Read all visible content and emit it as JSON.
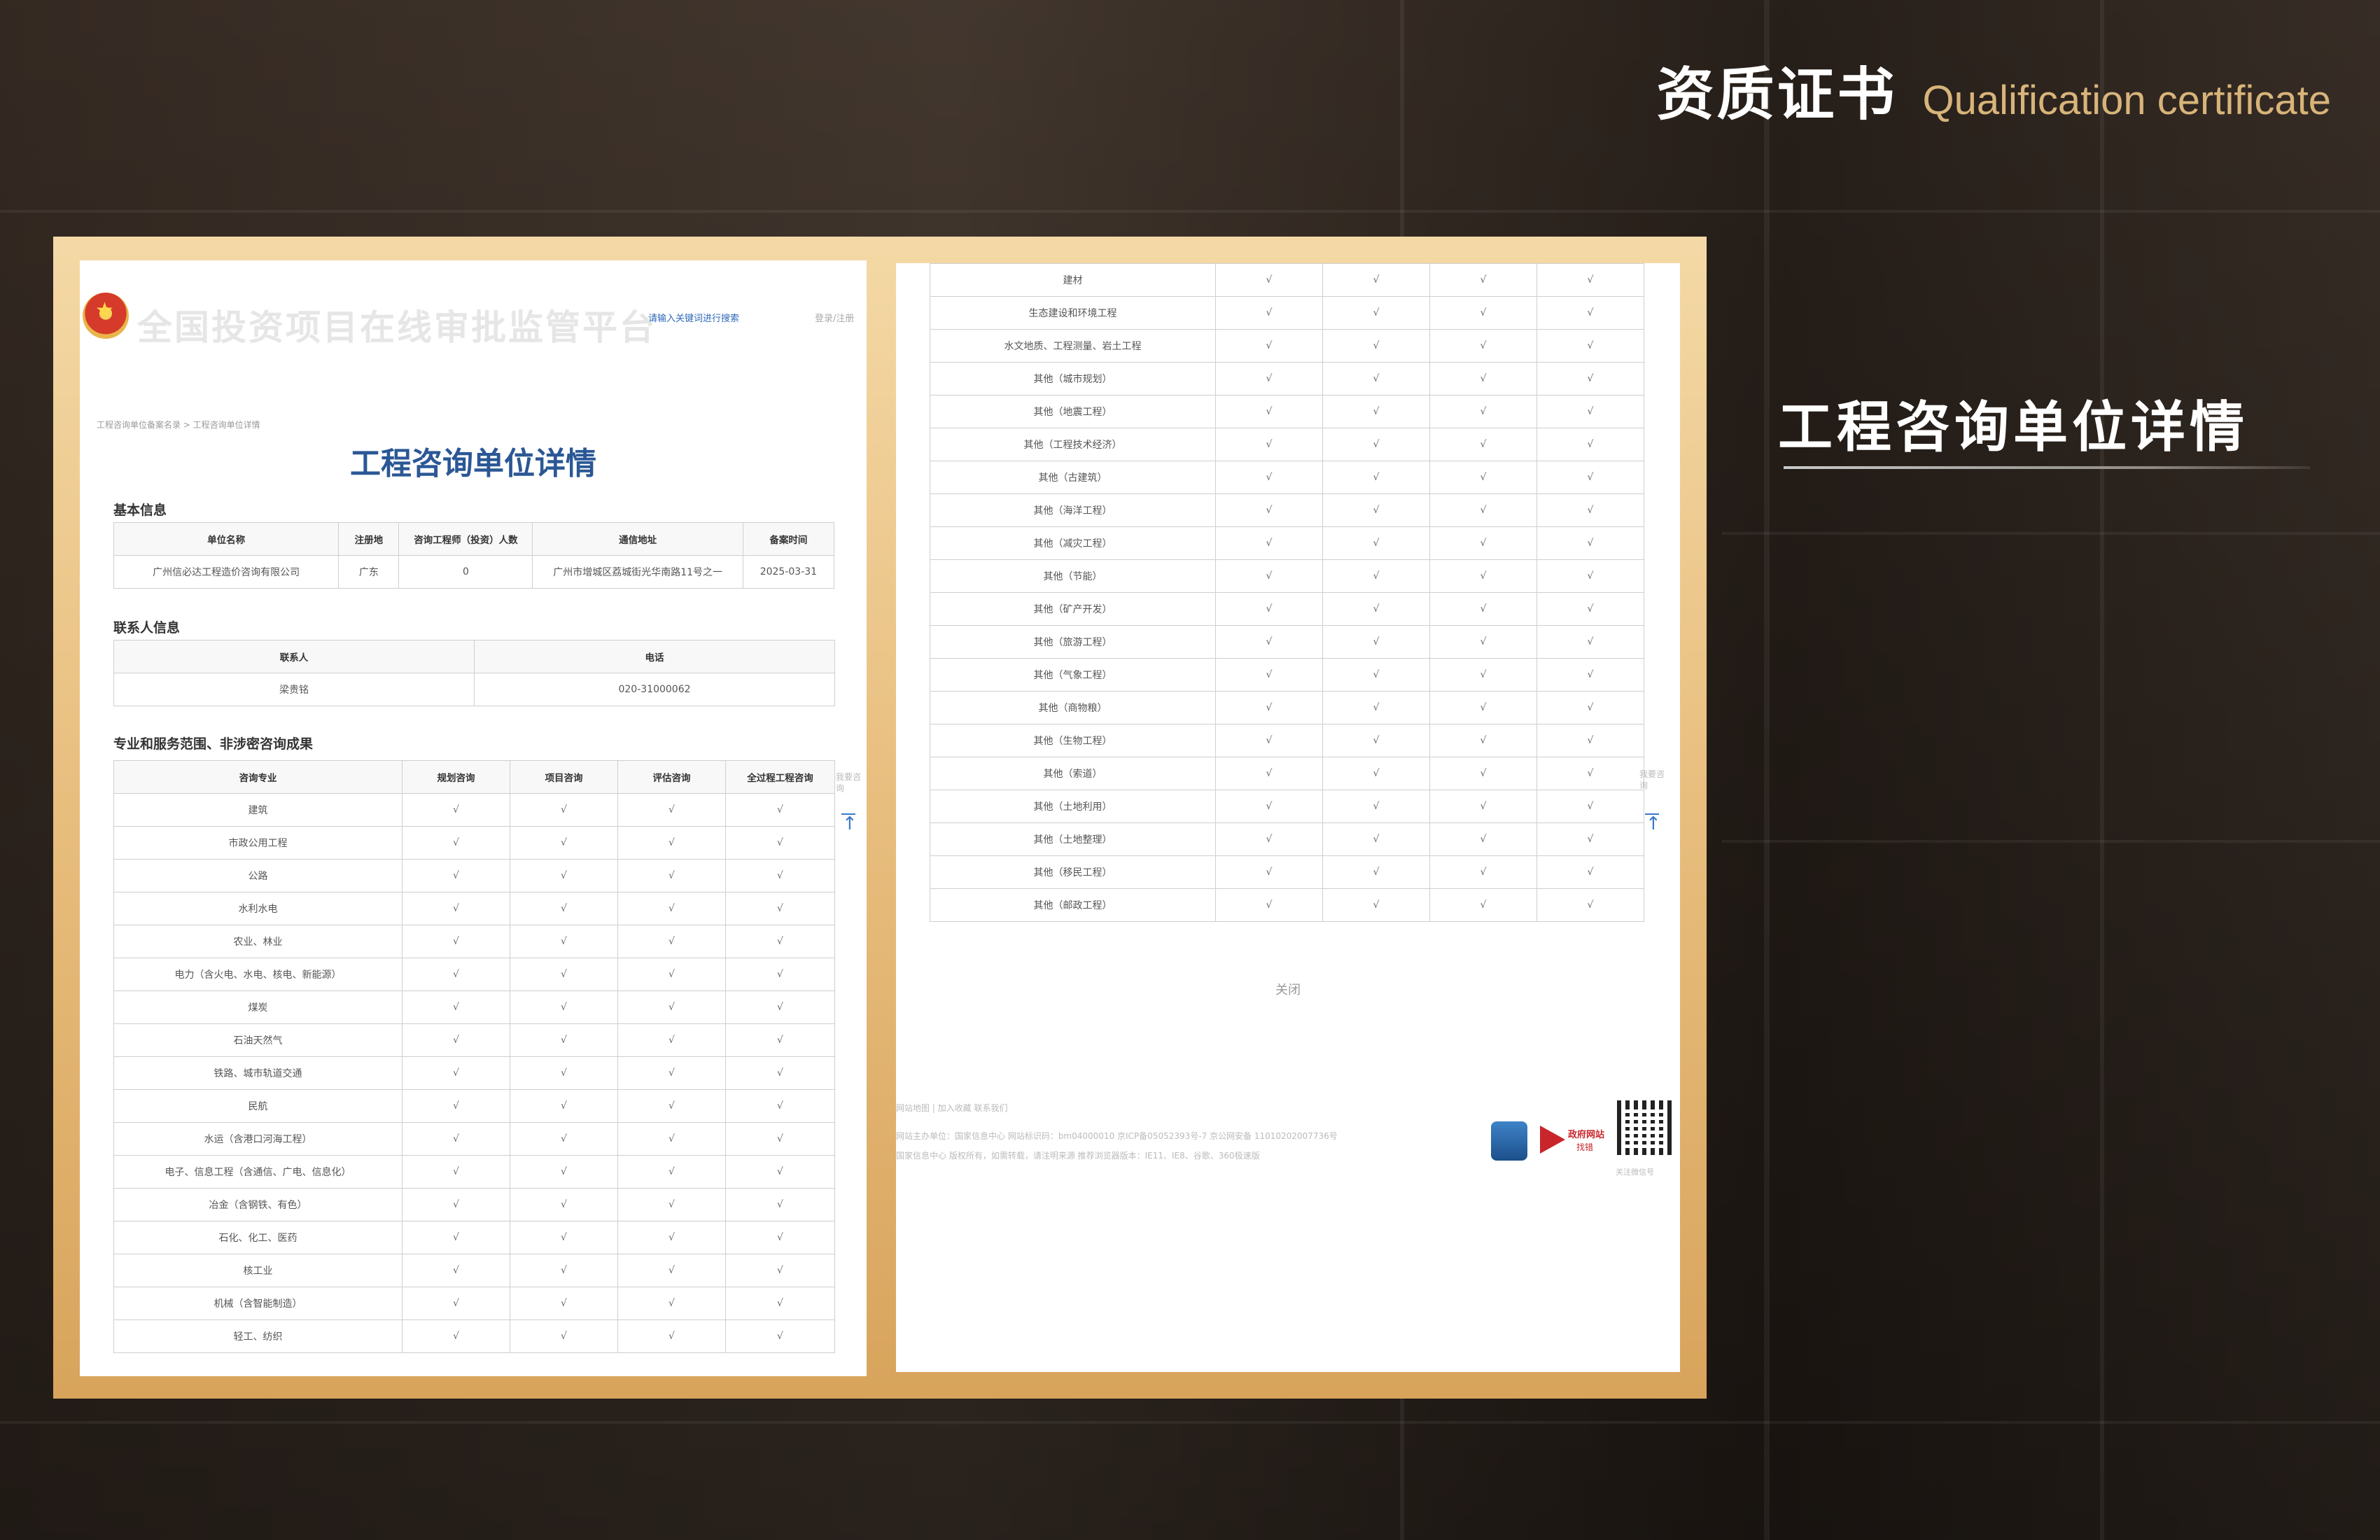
{
  "header": {
    "title_cn": "资质证书",
    "title_en": "Qualification certificate"
  },
  "side": {
    "title": "工程咨询单位详情"
  },
  "left_page": {
    "platform_title": "全国投资项目在线审批监管平台",
    "search_link": "请输入关键词进行搜索",
    "login": "登录/注册",
    "breadcrumb": "工程咨询单位备案名录 > 工程咨询单位详情",
    "page_title": "工程咨询单位详情",
    "basic_info": {
      "heading": "基本信息",
      "headers": [
        "单位名称",
        "注册地",
        "咨询工程师（投资）人数",
        "通信地址",
        "备案时间"
      ],
      "row": [
        "广州信必达工程造价咨询有限公司",
        "广东",
        "0",
        "广州市增城区荔城街光华南路11号之一",
        "2025-03-31"
      ]
    },
    "contact_info": {
      "heading": "联系人信息",
      "headers": [
        "联系人",
        "电话"
      ],
      "row": [
        "梁贵铭",
        "020-31000062"
      ]
    },
    "scope": {
      "heading": "专业和服务范围、非涉密咨询成果",
      "headers": [
        "咨询专业",
        "规划咨询",
        "项目咨询",
        "评估咨询",
        "全过程工程咨询"
      ],
      "check": "√",
      "rows": [
        "建筑",
        "市政公用工程",
        "公路",
        "水利水电",
        "农业、林业",
        "电力（含火电、水电、核电、新能源）",
        "煤炭",
        "石油天然气",
        "铁路、城市轨道交通",
        "民航",
        "水运（含港口河海工程）",
        "电子、信息工程（含通信、广电、信息化）",
        "冶金（含钢铁、有色）",
        "石化、化工、医药",
        "核工业",
        "机械（含智能制造）",
        "轻工、纺织"
      ]
    },
    "rail_text": "我要咨询"
  },
  "right_page": {
    "check": "√",
    "rows": [
      "建材",
      "生态建设和环境工程",
      "水文地质、工程测量、岩土工程",
      "其他（城市规划）",
      "其他（地震工程）",
      "其他（工程技术经济）",
      "其他（古建筑）",
      "其他（海洋工程）",
      "其他（减灾工程）",
      "其他（节能）",
      "其他（矿产开发）",
      "其他（旅游工程）",
      "其他（气象工程）",
      "其他（商物粮）",
      "其他（生物工程）",
      "其他（索道）",
      "其他（土地利用）",
      "其他（土地整理）",
      "其他（移民工程）",
      "其他（邮政工程）"
    ],
    "close": "关闭",
    "rail_text": "我要咨询",
    "footer": {
      "line1": "网站地图 | 加入收藏     联系我们",
      "line2": "网站主办单位：国家信息中心   网站标识码：bm04000010   京ICP备05052393号-7   京公网安备 11010202007736号",
      "line3": "国家信息中心 版权所有，如需转载，请注明来源   推荐浏览器版本：IE11、IE8、谷歌、360极速版",
      "badge2_t1": "政府网站",
      "badge2_t2": "找错",
      "qr_caption": "关注微信号"
    }
  },
  "colors": {
    "gold": "#d8b47a",
    "title_blue": "#2b5795"
  }
}
